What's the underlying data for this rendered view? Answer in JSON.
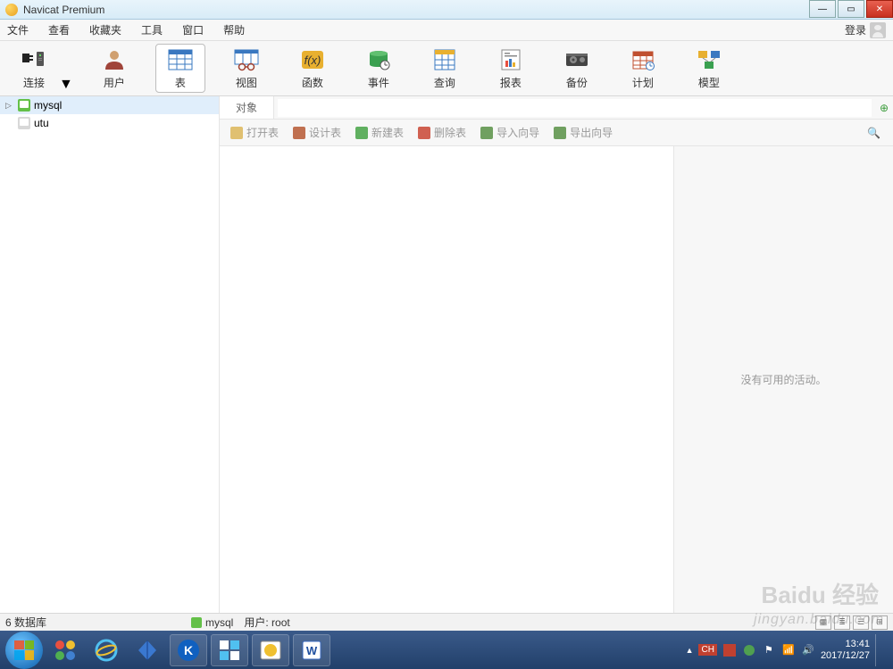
{
  "title": "Navicat Premium",
  "menu": {
    "file": "文件",
    "view": "查看",
    "favorites": "收藏夹",
    "tools": "工具",
    "window": "窗口",
    "help": "帮助",
    "login": "登录"
  },
  "toolbar": {
    "connection": "连接",
    "user": "用户",
    "table": "表",
    "view": "视图",
    "function": "函数",
    "event": "事件",
    "query": "查询",
    "report": "报表",
    "backup": "备份",
    "schedule": "计划",
    "model": "模型"
  },
  "tree": {
    "items": [
      {
        "name": "mysql",
        "expanded": true,
        "selected": true
      },
      {
        "name": "utu",
        "expanded": false,
        "selected": false
      }
    ]
  },
  "objectbar": {
    "tab": "对象"
  },
  "actions": {
    "open": "打开表",
    "design": "设计表",
    "new": "新建表",
    "delete": "删除表",
    "import": "导入向导",
    "export": "导出向导"
  },
  "right_panel": {
    "empty": "没有可用的活动。"
  },
  "status": {
    "db_count": "6 数据库",
    "conn": "mysql",
    "user_label": "用户: root"
  },
  "taskbar": {
    "ime": "CH",
    "time": "13:41",
    "date": "2017/12/27"
  },
  "watermark": {
    "brand": "Baidu 经验",
    "url": "jingyan.baidu.com"
  }
}
